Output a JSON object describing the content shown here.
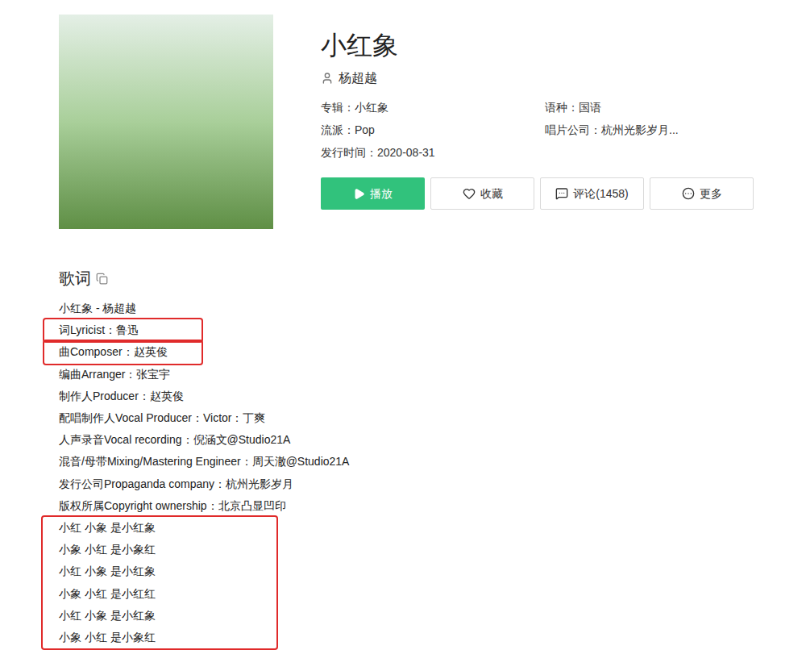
{
  "song": {
    "title": "小红象",
    "artist": "杨超越"
  },
  "info": [
    {
      "label": "专辑：小红象"
    },
    {
      "label": "语种：国语"
    },
    {
      "label": "流派：Pop"
    },
    {
      "label": "唱片公司：杭州光影岁月..."
    },
    {
      "label": "发行时间：2020-08-31"
    }
  ],
  "buttons": [
    {
      "label": "播放",
      "kind": "primary"
    },
    {
      "label": "收藏",
      "kind": "favorite"
    },
    {
      "label": "评论(1458)",
      "kind": "comment"
    },
    {
      "label": "更多",
      "kind": "more"
    }
  ],
  "lyrics": {
    "heading": "歌词",
    "groups": [
      {
        "highlighted": false,
        "lines": [
          "小红象 - 杨超越"
        ]
      },
      {
        "highlighted": true,
        "lines": [
          "词Lyricist：鲁迅"
        ]
      },
      {
        "highlighted": true,
        "lines": [
          "曲Composer：赵英俊"
        ]
      },
      {
        "highlighted": false,
        "lines": [
          "编曲Arranger：张宝宇",
          "制作人Producer：赵英俊",
          "配唱制作人Vocal Producer：Victor：丁爽",
          "人声录音Vocal recording：倪涵文@Studio21A",
          "混音/母带Mixing/Mastering Engineer：周天澈@Studio21A",
          "发行公司Propaganda company：杭州光影岁月",
          "版权所属Copyright ownership：北京凸显凹印"
        ]
      },
      {
        "highlighted": true,
        "lines": [
          "小红 小象 是小红象",
          "小象 小红 是小象红",
          "小红 小象 是小红象",
          "小象 小红 是小红红",
          "小红 小象 是小红象",
          "小象 小红 是小象红"
        ]
      }
    ]
  }
}
